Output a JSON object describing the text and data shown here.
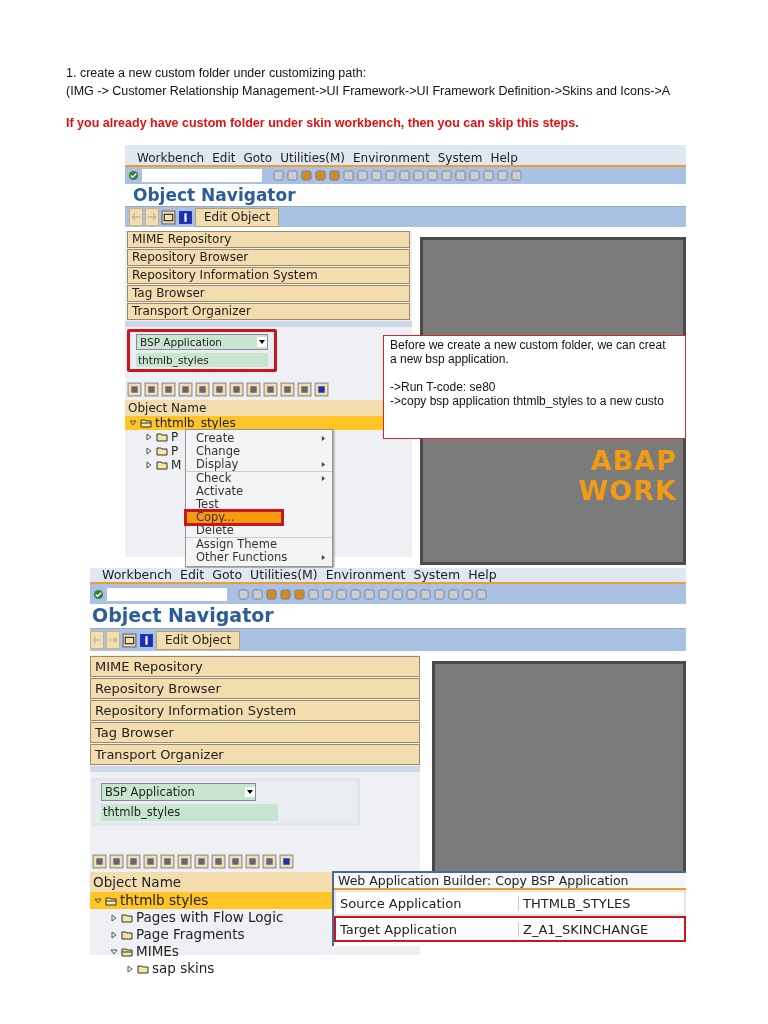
{
  "intro": {
    "step": "1. create a new custom folder under customizing path:",
    "path": "(IMG -> Customer Relationship Management->UI Framework->UI Framework Definition->Skins and Icons->A"
  },
  "note": "If you already have custom folder under skin workbench, then you can skip this steps.",
  "screenshots": [
    {
      "menu_bar": [
        "Workbench",
        "Edit",
        "Goto",
        "Utilities(M)",
        "Environment",
        "System",
        "Help"
      ],
      "title": "Object Navigator",
      "edit_button": "Edit Object",
      "tools": [
        "MIME Repository",
        "Repository Browser",
        "Repository Information System",
        "Tag Browser",
        "Transport Organizer"
      ],
      "object_type": "BSP Application",
      "object_name": "thtmlb_styles",
      "fields_highlighted": true,
      "column": "Object Name",
      "tree": {
        "label": "thtmlb_styles",
        "expanded": true,
        "selected": true,
        "children": [
          {
            "label": "P",
            "expanded": false,
            "selected": false
          },
          {
            "label": "P",
            "expanded": false,
            "selected": false
          },
          {
            "label": "M",
            "expanded": false,
            "selected": false
          }
        ]
      },
      "splash": [
        "ABAP",
        "WORK"
      ],
      "context_menu": [
        {
          "label": "Create",
          "has_submenu": true,
          "selected": false
        },
        {
          "label": "Change",
          "has_submenu": false,
          "selected": false
        },
        {
          "label": "Display",
          "has_submenu": true,
          "selected": false
        },
        {
          "label": "Check",
          "has_submenu": true,
          "selected": false
        },
        {
          "label": "Activate",
          "has_submenu": false,
          "selected": false
        },
        {
          "label": "Test",
          "has_submenu": false,
          "selected": false
        },
        {
          "label": "Copy...",
          "has_submenu": false,
          "selected": true
        },
        {
          "label": "Delete",
          "has_submenu": false,
          "selected": false
        },
        {
          "label": "Assign Theme",
          "has_submenu": false,
          "selected": false
        },
        {
          "label": "Other Functions",
          "has_submenu": true,
          "selected": false
        }
      ],
      "callout": {
        "intro": [
          "Before we create a new custom folder, we can creat",
          "a new bsp application."
        ],
        "steps": [
          "->Run T-code: se80",
          "->copy bsp application thtmlb_styles to a new custo"
        ]
      }
    },
    {
      "menu_bar": [
        "Workbench",
        "Edit",
        "Goto",
        "Utilities(M)",
        "Environment",
        "System",
        "Help"
      ],
      "title": "Object Navigator",
      "edit_button": "Edit Object",
      "tools": [
        "MIME Repository",
        "Repository Browser",
        "Repository Information System",
        "Tag Browser",
        "Transport Organizer"
      ],
      "object_type": "BSP Application",
      "object_name": "thtmlb_styles",
      "fields_highlighted": false,
      "column": "Object Name",
      "tree": {
        "label": "thtmlb styles",
        "expanded": true,
        "selected": true,
        "children": [
          {
            "label": "Pages with Flow Logic",
            "expanded": false,
            "selected": false
          },
          {
            "label": "Page Fragments",
            "expanded": false,
            "selected": false
          },
          {
            "label": "MIMEs",
            "expanded": true,
            "selected": false,
            "children": [
              {
                "label": "sap skins",
                "expanded": false,
                "selected": false
              }
            ]
          }
        ]
      },
      "dialog": {
        "title": "Web Application Builder: Copy BSP Application",
        "fields": [
          {
            "label": "Source Application",
            "value": "THTMLB_STYLES",
            "highlighted": false
          },
          {
            "label": "Target Application",
            "value": "Z_A1_SKINCHANGE",
            "highlighted": true
          }
        ]
      }
    }
  ]
}
